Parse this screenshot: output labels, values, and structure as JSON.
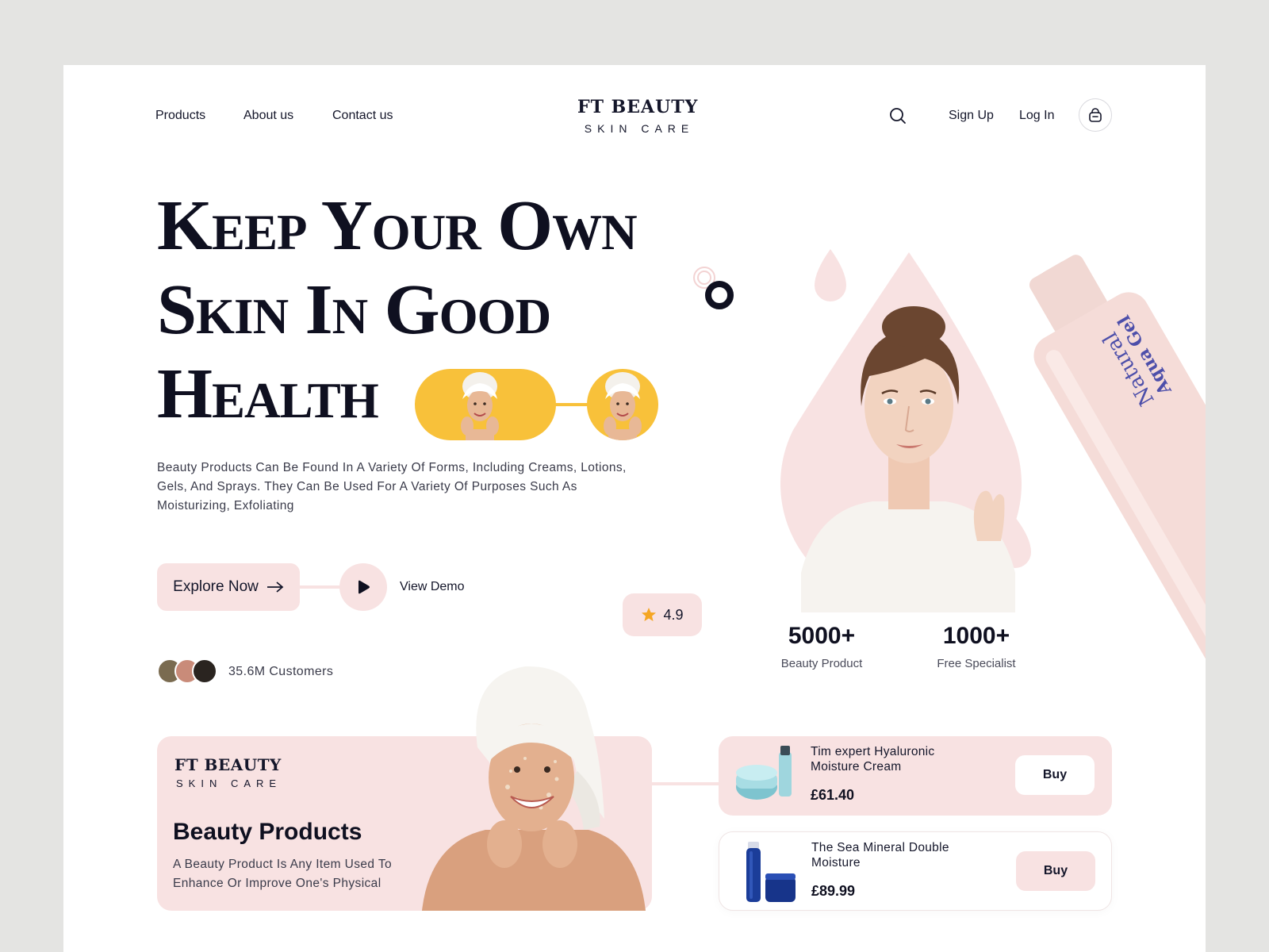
{
  "nav": {
    "links": [
      "Products",
      "About us",
      "Contact us"
    ],
    "sign_up": "Sign Up",
    "log_in": "Log In",
    "icons": {
      "search": "search-icon",
      "cart": "shopping-bag-icon"
    }
  },
  "brand": {
    "title": "FT BEAUTY",
    "subtitle": "SKIN CARE"
  },
  "hero": {
    "headline_lines": [
      "Keep Your Own",
      "Skin In Good",
      "Health"
    ],
    "description": "Beauty Products Can Be Found In A Variety Of Forms, Including Creams, Lotions, Gels, And Sprays. They Can Be Used For A Variety Of Purposes Such As Moisturizing, Exfoliating",
    "explore_label": "Explore Now",
    "view_demo_label": "View Demo",
    "rating": "4.9",
    "customers": "35.6M Customers"
  },
  "stats": [
    {
      "value": "5000+",
      "label": "Beauty Product"
    },
    {
      "value": "1000+",
      "label": "Free Specialist"
    }
  ],
  "product_bottle": {
    "line1": "Natural",
    "line2": "Aqua Gel"
  },
  "beauty_card": {
    "brand_title": "FT BEAUTY",
    "brand_subtitle": "SKIN CARE",
    "title": "Beauty Products",
    "description": "A Beauty Product Is Any Item Used To Enhance Or Improve One's Physical"
  },
  "products": [
    {
      "name": "Tim expert Hyaluronic Moisture Cream",
      "price": "£61.40",
      "buy_label": "Buy"
    },
    {
      "name": "The Sea Mineral Double Moisture",
      "price": "£89.99",
      "buy_label": "Buy"
    }
  ],
  "colors": {
    "accent_pink": "#f8e2e2",
    "text_dark": "#0f1020",
    "photo_yellow": "#f8c13a",
    "star": "#f5a623",
    "background": "#e4e4e2"
  }
}
